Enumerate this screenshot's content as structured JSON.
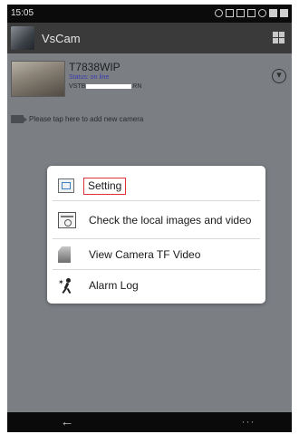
{
  "status_bar": {
    "time": "15:05"
  },
  "action_bar": {
    "title": "VsCam"
  },
  "camera": {
    "name": "T7838WIP",
    "status": "Status: on line",
    "id_prefix": "VSTB",
    "id_suffix": "RN"
  },
  "add_camera": {
    "label": "Please tap here to add new camera"
  },
  "dialog": {
    "items": [
      {
        "label": "Setting",
        "icon": "setting-icon"
      },
      {
        "label": "Check the local images and video",
        "icon": "gallery-icon"
      },
      {
        "label": "View Camera TF Video",
        "icon": "sdcard-icon"
      },
      {
        "label": "Alarm Log",
        "icon": "alarm-icon"
      }
    ],
    "highlight_color": "#e0303a"
  },
  "nav_bar": {
    "back_glyph": "←",
    "more_glyph": "···"
  }
}
